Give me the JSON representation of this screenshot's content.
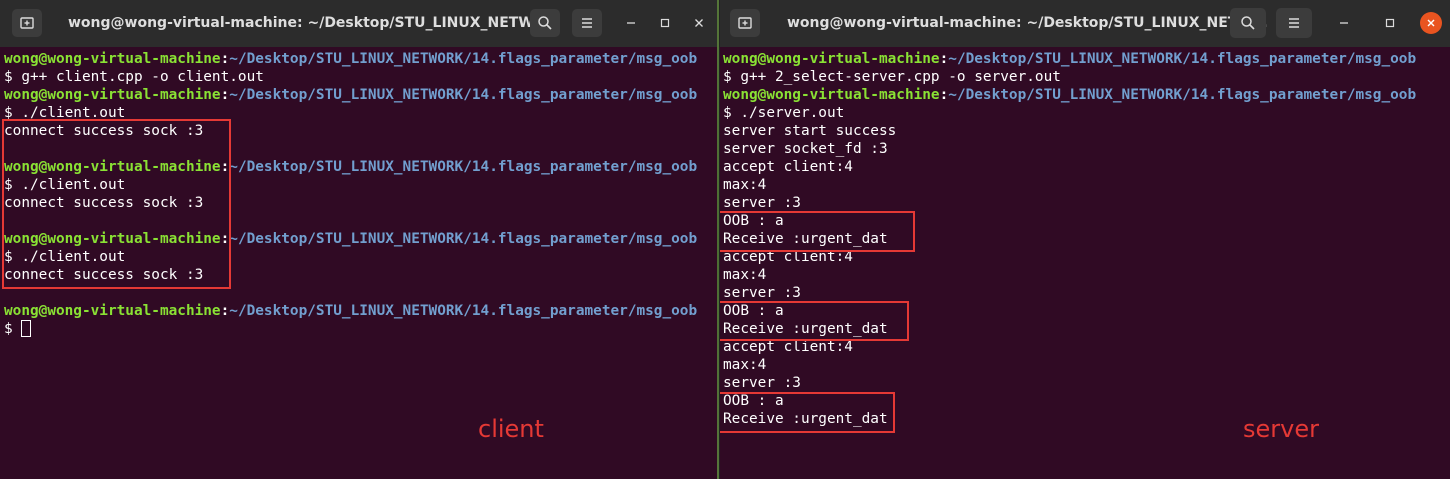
{
  "left_window": {
    "title": "wong@wong-virtual-machine: ~/Desktop/STU_LINUX_NETW...",
    "lines": [
      {
        "kind": "prompt",
        "user": "wong@wong-virtual-machine",
        "path": "~/Desktop/STU_LINUX_NETWORK/14.flags_parameter/msg_oob"
      },
      {
        "kind": "text",
        "text": "$ g++ client.cpp -o client.out"
      },
      {
        "kind": "prompt",
        "user": "wong@wong-virtual-machine",
        "path": "~/Desktop/STU_LINUX_NETWORK/14.flags_parameter/msg_oob"
      },
      {
        "kind": "text",
        "text": "$ ./client.out"
      },
      {
        "kind": "text",
        "text": "connect success sock :3"
      },
      {
        "kind": "text",
        "text": ""
      },
      {
        "kind": "prompt",
        "user": "wong@wong-virtual-machine",
        "path": "~/Desktop/STU_LINUX_NETWORK/14.flags_parameter/msg_oob"
      },
      {
        "kind": "text",
        "text": "$ ./client.out"
      },
      {
        "kind": "text",
        "text": "connect success sock :3"
      },
      {
        "kind": "text",
        "text": ""
      },
      {
        "kind": "prompt",
        "user": "wong@wong-virtual-machine",
        "path": "~/Desktop/STU_LINUX_NETWORK/14.flags_parameter/msg_oob"
      },
      {
        "kind": "text",
        "text": "$ ./client.out"
      },
      {
        "kind": "text",
        "text": "connect success sock :3"
      },
      {
        "kind": "text",
        "text": ""
      },
      {
        "kind": "prompt",
        "user": "wong@wong-virtual-machine",
        "path": "~/Desktop/STU_LINUX_NETWORK/14.flags_parameter/msg_oob"
      },
      {
        "kind": "cursor",
        "text": "$ "
      }
    ],
    "caption": "client"
  },
  "right_window": {
    "title": "wong@wong-virtual-machine: ~/Desktop/STU_LINUX_NETW...",
    "lines": [
      {
        "kind": "prompt",
        "user": "wong@wong-virtual-machine",
        "path": "~/Desktop/STU_LINUX_NETWORK/14.flags_parameter/msg_oob"
      },
      {
        "kind": "text",
        "text": "$ g++ 2_select-server.cpp -o server.out"
      },
      {
        "kind": "prompt",
        "user": "wong@wong-virtual-machine",
        "path": "~/Desktop/STU_LINUX_NETWORK/14.flags_parameter/msg_oob"
      },
      {
        "kind": "text",
        "text": "$ ./server.out"
      },
      {
        "kind": "text",
        "text": "server start success"
      },
      {
        "kind": "text",
        "text": "server socket_fd :3"
      },
      {
        "kind": "text",
        "text": "accept client:4"
      },
      {
        "kind": "text",
        "text": "max:4"
      },
      {
        "kind": "text",
        "text": "server :3"
      },
      {
        "kind": "text",
        "text": "OOB : a"
      },
      {
        "kind": "text",
        "text": "Receive :urgent_dat"
      },
      {
        "kind": "text",
        "text": "accept client:4"
      },
      {
        "kind": "text",
        "text": "max:4"
      },
      {
        "kind": "text",
        "text": "server :3"
      },
      {
        "kind": "text",
        "text": "OOB : a"
      },
      {
        "kind": "text",
        "text": "Receive :urgent_dat"
      },
      {
        "kind": "text",
        "text": "accept client:4"
      },
      {
        "kind": "text",
        "text": "max:4"
      },
      {
        "kind": "text",
        "text": "server :3"
      },
      {
        "kind": "text",
        "text": "OOB : a"
      },
      {
        "kind": "text",
        "text": "Receive :urgent_dat"
      }
    ],
    "caption": "server"
  },
  "colors": {
    "terminal_bg": "#300a24",
    "user": "#8ae234",
    "path": "#729fcf",
    "highlight": "#e53935",
    "close_button": "#e95420"
  }
}
